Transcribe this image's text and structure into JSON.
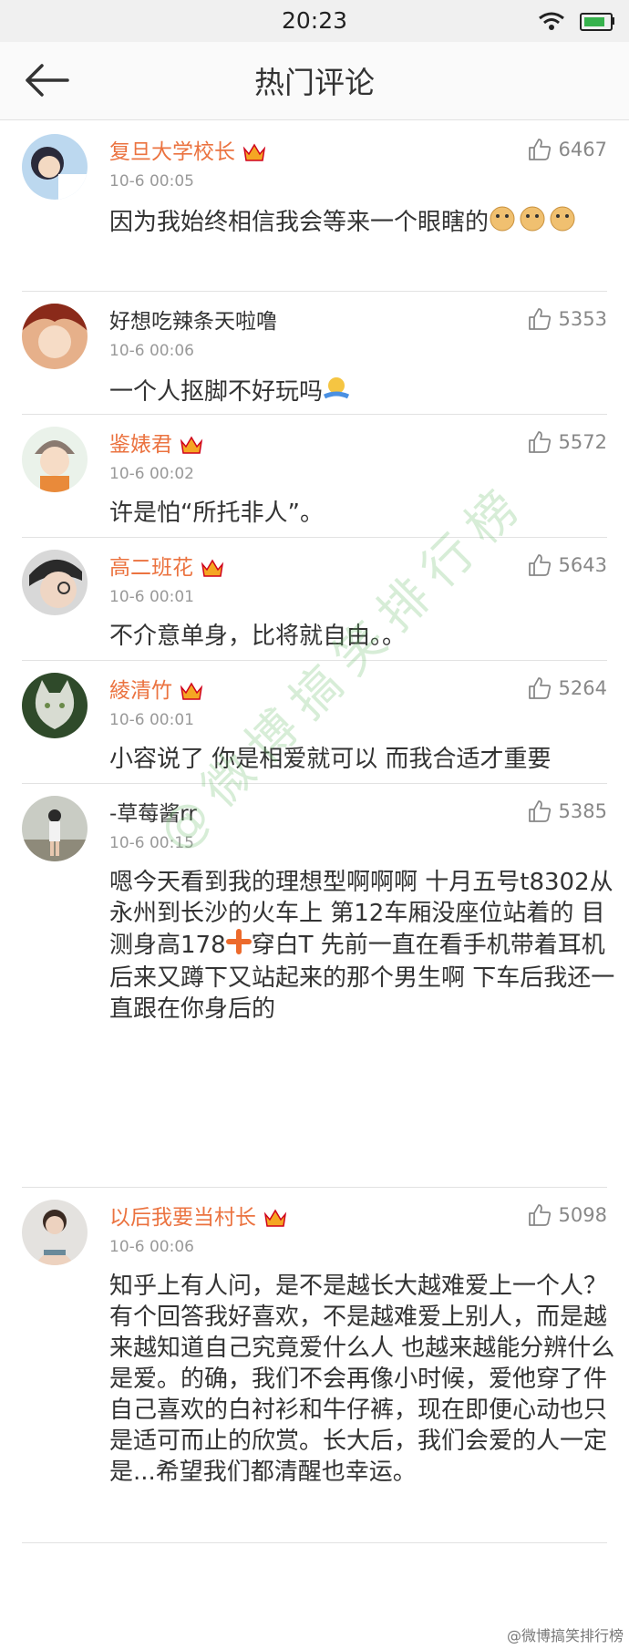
{
  "status_bar": {
    "time": "20:23"
  },
  "header": {
    "title": "热门评论"
  },
  "watermark": "@微博搞笑排行榜",
  "footer_mark": "@微博搞笑排行榜",
  "comments": [
    {
      "user": "复旦大学校长",
      "vip": true,
      "date": "10-6 00:05",
      "likes": "6467",
      "text": "因为我始终相信我会等来一个眼瞎的",
      "emoji": "doge-icon x3"
    },
    {
      "user": "好想吃辣条天啦噜",
      "vip": false,
      "date": "10-6 00:06",
      "likes": "5353",
      "text": "一个人抠脚不好玩吗",
      "emoji": "shrug-icon"
    },
    {
      "user": "鉴婊君",
      "vip": true,
      "date": "10-6 00:02",
      "likes": "5572",
      "text": "许是怕“所托非人”。"
    },
    {
      "user": "高二班花",
      "vip": true,
      "date": "10-6 00:01",
      "likes": "5643",
      "text": "不介意单身，比将就自由。。"
    },
    {
      "user": "綾清竹",
      "vip": true,
      "date": "10-6 00:01",
      "likes": "5264",
      "text": "小容说了 你是相爱就可以 而我合适才重要"
    },
    {
      "user": "-草莓酱rr",
      "vip": false,
      "date": "10-6 00:15",
      "likes": "5385",
      "text_a": "嗯今天看到我的理想型啊啊啊 十月五号t8302从永州到长沙的火车上 第12车厢没座位站着的 目测身高178",
      "text_b": "穿白T 先前一直在看手机带着耳机 后来又蹲下又站起来的那个男生啊 下车后我还一直跟在你身后的"
    },
    {
      "user": "以后我要当村长",
      "vip": true,
      "date": "10-6 00:06",
      "likes": "5098",
      "text": "知乎上有人问，是不是越长大越难爱上一个人？有个回答我好喜欢，不是越难爱上别人，而是越来越知道自己究竟爱什么人 也越来越能分辨什么是爱。的确，我们不会再像小时候，爱他穿了件自己喜欢的白衬衫和牛仔裤，现在即便心动也只是适可而止的欣赏。长大后，我们会爱的人一定是...希望我们都清醒也幸运。"
    }
  ],
  "colors": {
    "vip_name": "#eb7340",
    "divider": "#e2e2e2",
    "meta": "#999999",
    "watermark": "#6ebe6e"
  }
}
